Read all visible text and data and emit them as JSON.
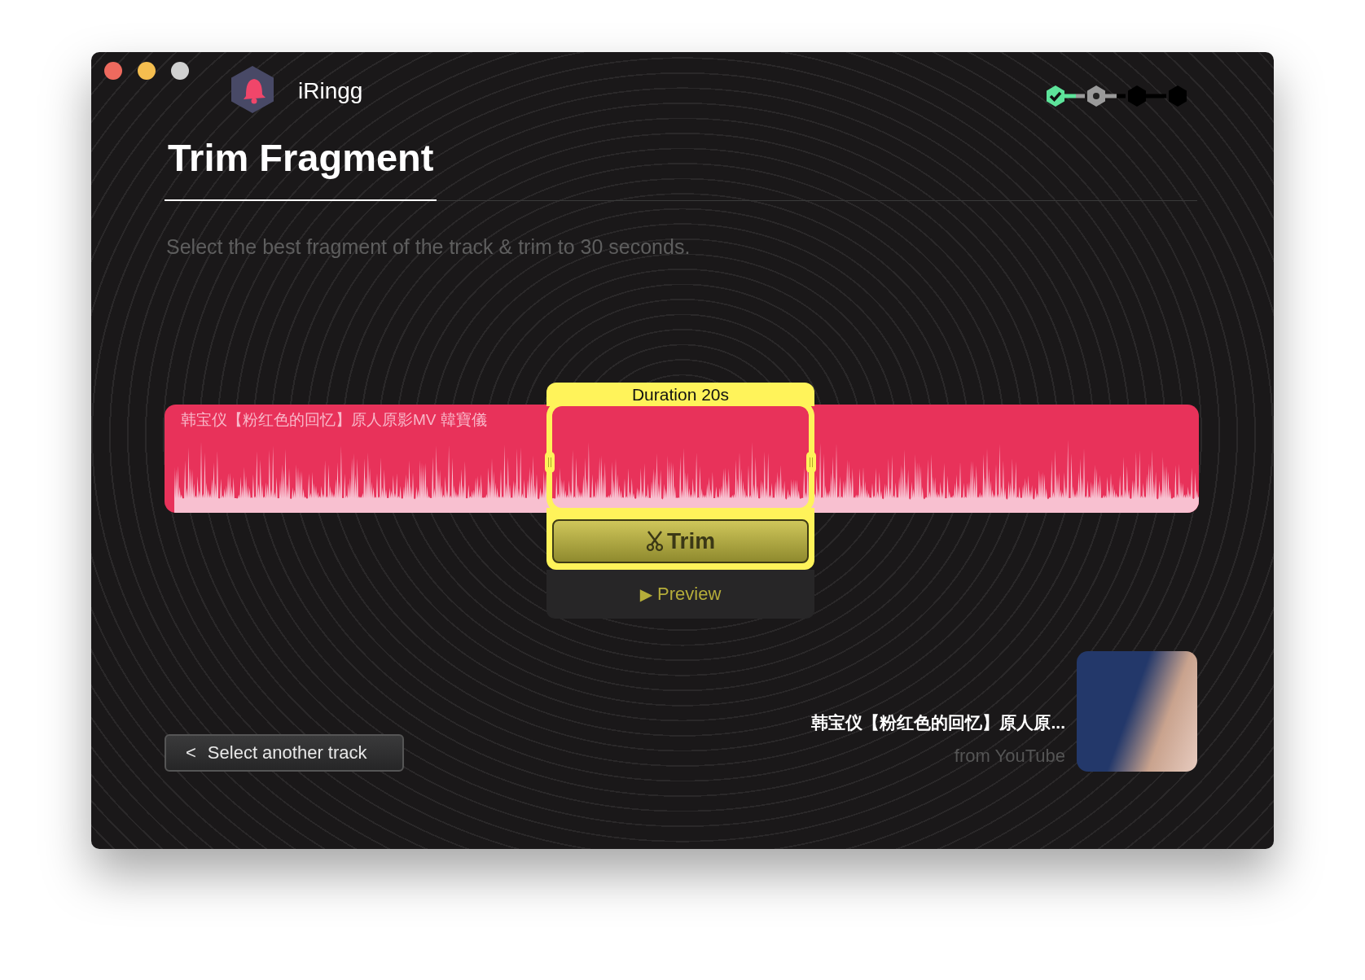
{
  "app": {
    "name": "iRingg"
  },
  "steps": [
    {
      "completed": true,
      "selected": false
    },
    {
      "completed": false,
      "selected": true
    },
    {
      "completed": false,
      "selected": false
    },
    {
      "completed": false,
      "selected": false
    }
  ],
  "page": {
    "title": "Trim Fragment",
    "subtitle": "Select the best fragment of the track & trim to 30 seconds."
  },
  "track": {
    "label": "韩宝仪【粉红色的回忆】原人原影MV 韓寶儀"
  },
  "selection": {
    "duration": "Duration 20s",
    "trim_button": "Trim",
    "preview_button": "Preview",
    "preview_icon": "▶"
  },
  "footer": {
    "back_button": "Select another track",
    "back_icon": "<",
    "song_title": "韩宝仪【粉红色的回忆】原人原...",
    "source": "from YouTube"
  }
}
